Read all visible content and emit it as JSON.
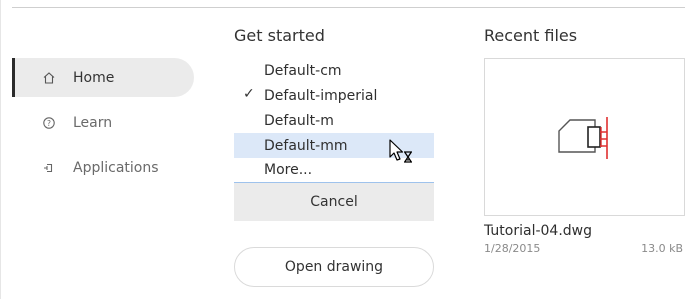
{
  "sidebar": {
    "items": [
      {
        "label": "Home",
        "icon": "home-icon",
        "active": true
      },
      {
        "label": "Learn",
        "icon": "learn-icon",
        "active": false
      },
      {
        "label": "Applications",
        "icon": "applications-icon",
        "active": false
      }
    ]
  },
  "get_started": {
    "title": "Get started",
    "templates": [
      {
        "label": "Default-cm",
        "checked": false,
        "hovered": false
      },
      {
        "label": "Default-imperial",
        "checked": true,
        "hovered": false
      },
      {
        "label": "Default-m",
        "checked": false,
        "hovered": false
      },
      {
        "label": "Default-mm",
        "checked": false,
        "hovered": true
      },
      {
        "label": "More...",
        "checked": false,
        "hovered": false
      }
    ],
    "checkmark": "✓",
    "cancel_label": "Cancel",
    "open_label": "Open drawing"
  },
  "recent_files": {
    "title": "Recent files",
    "files": [
      {
        "name": "Tutorial-04.dwg",
        "date": "1/28/2015",
        "size": "13.0 kB"
      }
    ]
  },
  "colors": {
    "accent_hover": "#dce8f8",
    "accent_line": "#9ec2ec",
    "active_nav_bg": "#ebebeb",
    "drawing_red": "#e03030"
  },
  "cursor": {
    "icon": "busy-pointer-icon"
  }
}
